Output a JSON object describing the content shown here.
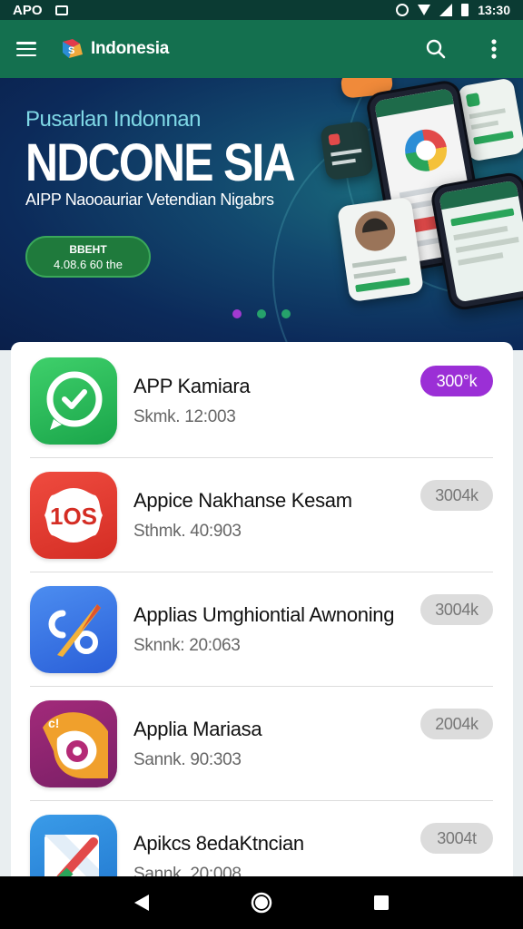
{
  "status_bar": {
    "left_text": "APO",
    "time": "13:30",
    "icons": [
      "image-icon",
      "alarm-icon",
      "wifi-icon",
      "signal-icon",
      "battery-icon"
    ]
  },
  "app_bar": {
    "logo_text": "Indonesia",
    "logo_tagline": "",
    "icons": [
      "menu-icon",
      "search-icon",
      "more-vert-icon"
    ]
  },
  "banner": {
    "eyebrow": "Pusarlan Indonnan",
    "title": "NDCONE SIA",
    "subtitle": "AIPP Naooauriar Vetendian Nigabrs",
    "cta_line1": "BBEHT",
    "cta_line2": "4.08.6 60 the",
    "dots": [
      {
        "color": "#a13ad0",
        "active": true
      },
      {
        "color": "#26a26b",
        "active": false
      },
      {
        "color": "#26a26b",
        "active": false
      }
    ]
  },
  "apps": [
    {
      "title": "APP Kamiara",
      "subtitle": "Skmk. 12:003",
      "badge": "300°k",
      "badge_bg": "#9b2fd6",
      "badge_fg": "#ffffff",
      "icon": "whatsapp-style-icon"
    },
    {
      "title": "Appice Nakhanse Kesam",
      "subtitle": "Sthmk. 40:903",
      "badge": "3004k",
      "badge_bg": "#dcdcdc",
      "badge_fg": "#777777",
      "icon": "ios-badge-icon"
    },
    {
      "title": "Applias Umghiontial Awnoning",
      "subtitle": "Sknnk: 20:063",
      "badge": "3004k",
      "badge_bg": "#dcdcdc",
      "badge_fg": "#777777",
      "icon": "compass-link-icon"
    },
    {
      "title": "Applia Mariasa",
      "subtitle": "Sannk. 90:303",
      "badge": "2004k",
      "badge_bg": "#dcdcdc",
      "badge_fg": "#777777",
      "icon": "swirl-icon"
    },
    {
      "title": "Apikcs 8edaKtncian",
      "subtitle": "Sannk. 20:008",
      "badge": "3004t",
      "badge_bg": "#dcdcdc",
      "badge_fg": "#777777",
      "icon": "maps-style-icon"
    }
  ],
  "colors": {
    "app_bar": "#14704f",
    "status_bar": "#0b3b33",
    "accent_purple": "#9b2fd6"
  },
  "nav_bar": {
    "icons": [
      "back-icon",
      "home-icon",
      "recents-icon"
    ]
  }
}
